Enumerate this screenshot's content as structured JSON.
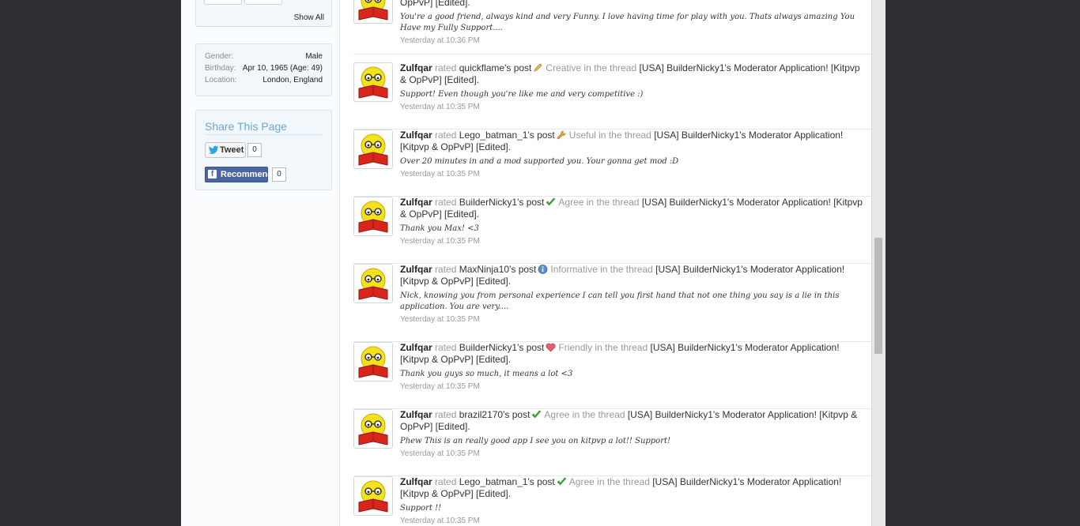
{
  "sidebar": {
    "show_all": "Show All",
    "profile": {
      "gender_label": "Gender:",
      "gender": "Male",
      "birthday_label": "Birthday:",
      "birthday": "Apr 10, 1965 (Age: 49)",
      "location_label": "Location:",
      "location": "London, England"
    },
    "share": {
      "title": "Share This Page",
      "tweet_label": "Tweet",
      "tweet_count": "0",
      "recommend_label": "Recommend",
      "recommend_count": "0"
    }
  },
  "feed": {
    "top_partial": {
      "title_tail": "OpPvP] [Edited].",
      "quote": "You're a good friend, always kind and very Funny. I love having time for play with you. Thats always amazing You Have my Fully Support....",
      "time": "Yesterday at 10:36 PM"
    },
    "items": [
      {
        "user": "Zulfqar",
        "rated": "rated",
        "poster": "quickflame's post",
        "rating": "Creative",
        "icon": "pencil-icon",
        "in_thread": "in the thread",
        "thread": "[USA] BuilderNicky1's Moderator Application! [Kitpvp & OpPvP] [Edited].",
        "quote": "Support! Even though you're like me and very competitive :)",
        "time": "Yesterday at 10:35 PM"
      },
      {
        "user": "Zulfqar",
        "rated": "rated",
        "poster": "Lego_batman_1's post",
        "rating": "Useful",
        "icon": "wrench-icon",
        "in_thread": "in the thread",
        "thread": "[USA] BuilderNicky1's Moderator Application! [Kitpvp & OpPvP] [Edited].",
        "quote": "Over 20 minutes in and a mod supported you. Your gonna get mod :D",
        "time": "Yesterday at 10:35 PM"
      },
      {
        "user": "Zulfqar",
        "rated": "rated",
        "poster": "BuilderNicky1's post",
        "rating": "Agree",
        "icon": "checkmark-icon",
        "in_thread": "in the thread",
        "thread": "[USA] BuilderNicky1's Moderator Application! [Kitpvp & OpPvP] [Edited].",
        "quote": "Thank you Max! <3",
        "time": "Yesterday at 10:35 PM"
      },
      {
        "user": "Zulfqar",
        "rated": "rated",
        "poster": "MaxNinja10's post",
        "rating": "Informative",
        "icon": "info-icon",
        "in_thread": "in the thread",
        "thread": "[USA] BuilderNicky1's Moderator Application! [Kitpvp & OpPvP] [Edited].",
        "quote": "Nick, knowing you from personal experience I can tell you first hand that not one thing you say is a lie in this application. You are very....",
        "time": "Yesterday at 10:35 PM"
      },
      {
        "user": "Zulfqar",
        "rated": "rated",
        "poster": "BuilderNicky1's post",
        "rating": "Friendly",
        "icon": "heart-icon",
        "in_thread": "in the thread",
        "thread": "[USA] BuilderNicky1's Moderator Application! [Kitpvp & OpPvP] [Edited].",
        "quote": "Thank you guys so much, it means a lot <3",
        "time": "Yesterday at 10:35 PM"
      },
      {
        "user": "Zulfqar",
        "rated": "rated",
        "poster": "brazil2170's post",
        "rating": "Agree",
        "icon": "checkmark-icon",
        "in_thread": "in the thread",
        "thread": "[USA] BuilderNicky1's Moderator Application! [Kitpvp & OpPvP] [Edited].",
        "quote": "Phew This is an really good app I see you on kitpvp a lot!! Support!",
        "time": "Yesterday at 10:35 PM"
      },
      {
        "user": "Zulfqar",
        "rated": "rated",
        "poster": "Lego_batman_1's post",
        "rating": "Agree",
        "icon": "checkmark-icon",
        "in_thread": "in the thread",
        "thread": "[USA] BuilderNicky1's Moderator Application! [Kitpvp & OpPvP] [Edited].",
        "quote": "Support !!",
        "time": "Yesterday at 10:35 PM"
      }
    ]
  },
  "colors": {
    "background": "#2f2f33",
    "accent": "#6ea7d6",
    "facebook": "#4a66a0"
  }
}
